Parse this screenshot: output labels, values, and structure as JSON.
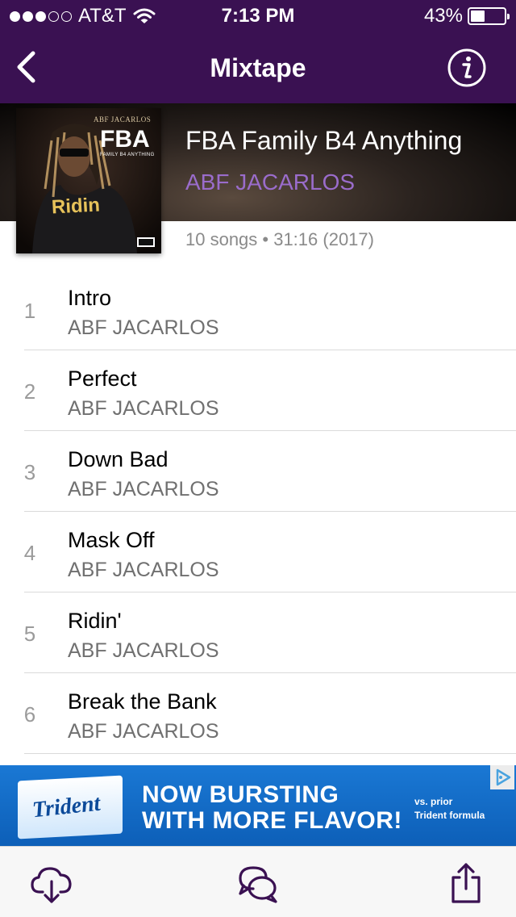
{
  "status_bar": {
    "carrier": "AT&T",
    "time": "7:13 PM",
    "battery_percent_text": "43%",
    "battery_level": 0.43,
    "signal_dots_filled": 3,
    "signal_dots_total": 5
  },
  "nav": {
    "title": "Mixtape",
    "back_icon": "chevron-left-icon",
    "info_icon": "info-circle-icon"
  },
  "album": {
    "title": "FBA Family B4 Anything",
    "artist": "ABF JACARLOS",
    "meta": "10 songs • 31:16 (2017)",
    "art": {
      "small_text": "ABF JACARLOS",
      "big_text": "FBA",
      "tag_text": "FAMILY B4 ANYTHING",
      "ridin_text": "Ridin"
    }
  },
  "tracks": [
    {
      "number": "1",
      "title": "Intro",
      "artist": "ABF JACARLOS"
    },
    {
      "number": "2",
      "title": "Perfect",
      "artist": "ABF JACARLOS"
    },
    {
      "number": "3",
      "title": "Down Bad",
      "artist": "ABF JACARLOS"
    },
    {
      "number": "4",
      "title": "Mask Off",
      "artist": "ABF JACARLOS"
    },
    {
      "number": "5",
      "title": "Ridin'",
      "artist": "ABF JACARLOS"
    },
    {
      "number": "6",
      "title": "Break the Bank",
      "artist": "ABF JACARLOS"
    }
  ],
  "ad": {
    "brand": "Trident",
    "line1": "NOW BURSTING",
    "line2": "WITH MORE FLAVOR!",
    "small1": "vs. prior",
    "small2": "Trident formula"
  },
  "toolbar": {
    "download_icon": "cloud-download-icon",
    "comments_icon": "chat-bubbles-icon",
    "share_icon": "share-icon"
  },
  "colors": {
    "header_purple": "#3a1152",
    "accent_purple": "#9a6ccb",
    "icon_purple": "#3a1152"
  }
}
